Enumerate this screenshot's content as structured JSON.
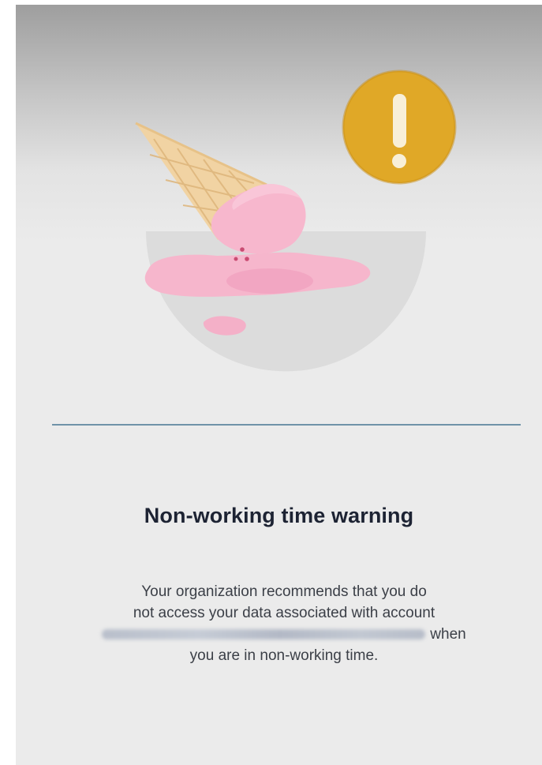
{
  "warning": {
    "title": "Non-working time warning",
    "message_line1": "Your organization recommends that you do",
    "message_line2": "not access your data associated with account",
    "message_line3_suffix": "when",
    "message_line4": "you are in non-working time."
  },
  "icons": {
    "illustration": "melted-ice-cream-icon",
    "alert": "exclamation-icon"
  },
  "colors": {
    "alert_badge": "#e0a827",
    "ice_cream": "#f6b3cb",
    "cone": "#efcf9a",
    "divider": "#6f93a8",
    "title_text": "#1d2333"
  }
}
